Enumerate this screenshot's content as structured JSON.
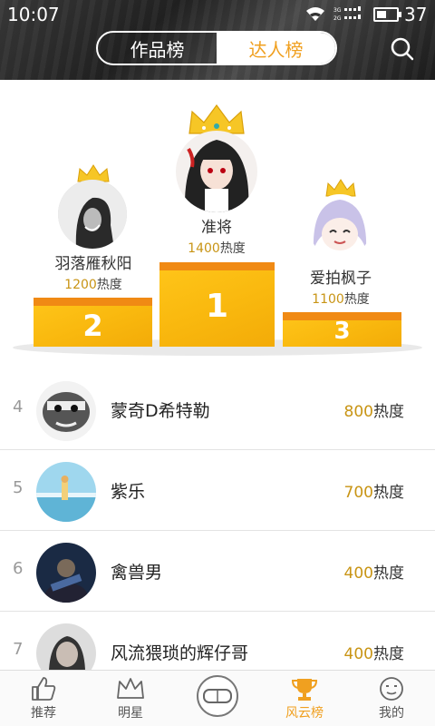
{
  "status_bar": {
    "time": "10:07",
    "battery": "37",
    "network": "3G 2G"
  },
  "header": {
    "tabs": [
      {
        "label": "作品榜",
        "active": false
      },
      {
        "label": "达人榜",
        "active": true
      }
    ],
    "accent_color": "#f0a020"
  },
  "podium": [
    {
      "rank": "1",
      "name": "准将",
      "heat_value": "1400",
      "heat_unit": "热度"
    },
    {
      "rank": "2",
      "name": "羽落雁秋阳",
      "heat_value": "1200",
      "heat_unit": "热度"
    },
    {
      "rank": "3",
      "name": "爱拍枫子",
      "heat_value": "1100",
      "heat_unit": "热度"
    }
  ],
  "ranking_list": [
    {
      "rank": "4",
      "name": "蒙奇D希特勒",
      "heat_value": "800",
      "heat_unit": "热度"
    },
    {
      "rank": "5",
      "name": "紫乐",
      "heat_value": "700",
      "heat_unit": "热度"
    },
    {
      "rank": "6",
      "name": "禽兽男",
      "heat_value": "400",
      "heat_unit": "热度"
    },
    {
      "rank": "7",
      "name": "风流猥琐的辉仔哥",
      "heat_value": "400",
      "heat_unit": "热度"
    }
  ],
  "bottom_nav": [
    {
      "label": "推荐",
      "icon": "thumbs-up-icon",
      "active": false
    },
    {
      "label": "明星",
      "icon": "crown-icon",
      "active": false
    },
    {
      "label": "",
      "icon": "vr-goggles-icon",
      "active": false
    },
    {
      "label": "风云榜",
      "icon": "trophy-icon",
      "active": true
    },
    {
      "label": "我的",
      "icon": "face-icon",
      "active": false
    }
  ]
}
